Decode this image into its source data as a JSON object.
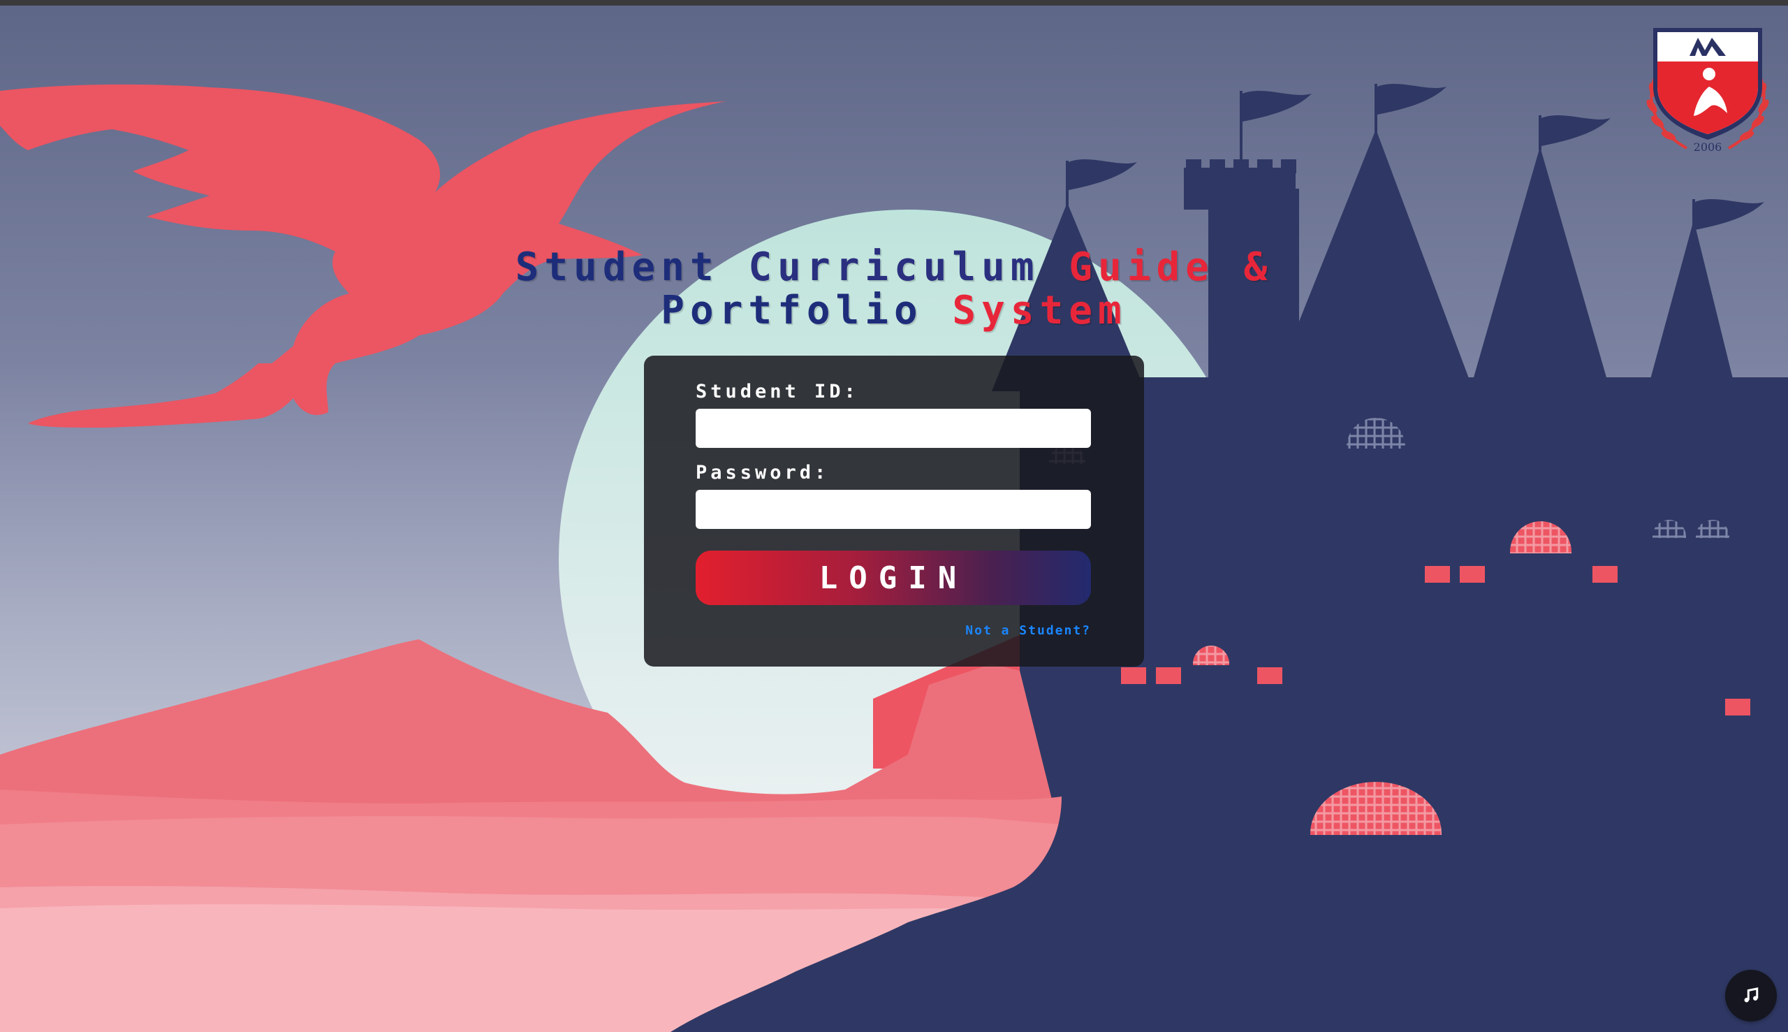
{
  "title": {
    "words": [
      "Student",
      "Curriculum",
      "Guide",
      "&",
      "Portfolio",
      "System"
    ]
  },
  "form": {
    "student_id_label": "Student ID:",
    "student_id_value": "",
    "password_label": "Password:",
    "password_value": "",
    "login_label": "LOGIN",
    "not_student_link": "Not a Student?"
  },
  "logo": {
    "year": "2006",
    "icon": "school-crest-icon"
  },
  "music": {
    "icon": "music-note-icon"
  },
  "colors": {
    "accent_red": "#e8263a",
    "navy": "#1e2d7a",
    "castle": "#2f3864",
    "coral": "#ee5563",
    "moon": "#d8ebe8",
    "link_blue": "#1b86ff"
  }
}
